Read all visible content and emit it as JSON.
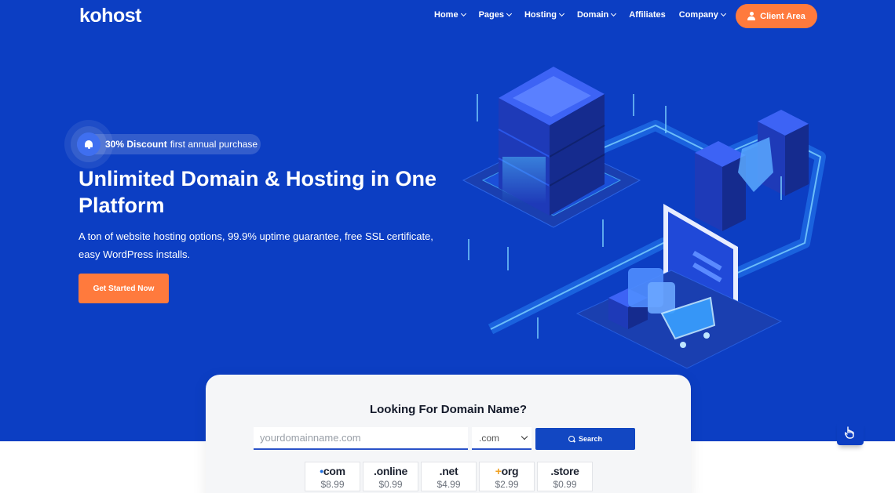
{
  "brand": {
    "logo": "kohost"
  },
  "nav": {
    "items": [
      {
        "label": "Home",
        "dropdown": true
      },
      {
        "label": "Pages",
        "dropdown": true
      },
      {
        "label": "Hosting",
        "dropdown": true
      },
      {
        "label": "Domain",
        "dropdown": true
      },
      {
        "label": "Affiliates",
        "dropdown": false
      },
      {
        "label": "Company",
        "dropdown": true
      }
    ],
    "client_area": "Client Area"
  },
  "hero": {
    "badge_strong": "30% Discount",
    "badge_text": "first annual purchase",
    "title": "Unlimited Domain & Hosting in One Platform",
    "subtitle": "A ton of website hosting options, 99.9% uptime guarantee, free SSL certificate, easy WordPress installs.",
    "cta": "Get Started Now"
  },
  "domain_search": {
    "title": "Looking For Domain Name?",
    "placeholder": "yourdomainname.com",
    "selected_tld": ".com",
    "search_label": "Search",
    "tlds": [
      {
        "dot": "•",
        "name": "com",
        "price": "$8.99",
        "dot_color": "#1f6fe0"
      },
      {
        "dot": ".",
        "name": "online",
        "price": "$0.99",
        "dot_color": "#1c2230"
      },
      {
        "dot": ".",
        "name": "net",
        "price": "$4.99",
        "dot_color": "#1c2230"
      },
      {
        "dot": "+",
        "name": "org",
        "price": "$2.99",
        "dot_color": "#f0a020"
      },
      {
        "dot": ".",
        "name": "store",
        "price": "$0.99",
        "dot_color": "#1c2230"
      }
    ]
  },
  "colors": {
    "hero_bg": "#0c3ec3",
    "accent": "#ff7a3d",
    "primary": "#1247c2"
  },
  "icons": [
    "bell-icon",
    "user-icon",
    "search-icon",
    "chevron-down-icon",
    "hand-pointer-icon"
  ]
}
